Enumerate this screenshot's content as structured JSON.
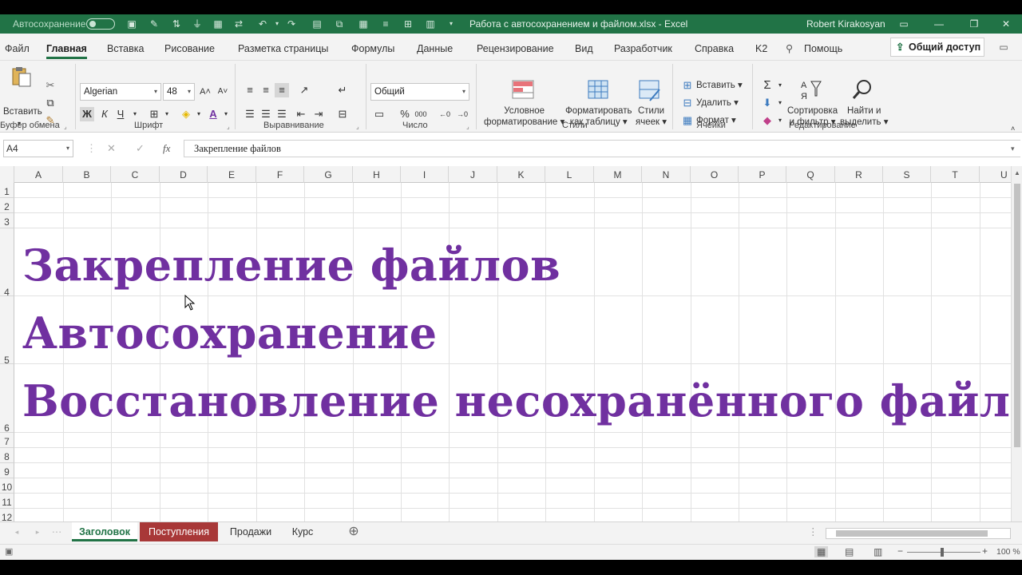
{
  "titlebar": {
    "autosave_label": "Автосохранение",
    "autosave_state": "off",
    "doc_title": "Работа с автосохранением и файлом.xlsx  -  Excel",
    "user": "Robert Kirakosyan"
  },
  "tabs": [
    "Файл",
    "Главная",
    "Вставка",
    "Рисование",
    "Разметка страницы",
    "Формулы",
    "Данные",
    "Рецензирование",
    "Вид",
    "Разработчик",
    "Справка",
    "K2"
  ],
  "active_tab": "Главная",
  "search_label": "Помощь",
  "share_label": "Общий доступ",
  "ribbon": {
    "clipboard": {
      "paste": "Вставить",
      "label": "Буфер обмена"
    },
    "font": {
      "name": "Algerian",
      "size": "48",
      "bold": "Ж",
      "italic": "К",
      "underline": "Ч",
      "label": "Шрифт"
    },
    "alignment": {
      "label": "Выравнивание"
    },
    "number": {
      "format": "Общий",
      "label": "Число"
    },
    "styles": {
      "conditional": [
        "Условное",
        "форматирование"
      ],
      "format_table": [
        "Форматировать",
        "как таблицу"
      ],
      "cell_styles": [
        "Стили",
        "ячеек"
      ],
      "label": "Стили"
    },
    "cells": {
      "insert": "Вставить",
      "delete": "Удалить",
      "format": "Формат",
      "label": "Ячейки"
    },
    "editing": {
      "sort": [
        "Сортировка",
        "и фильтр"
      ],
      "find": [
        "Найти и",
        "выделить"
      ],
      "label": "Редактирование"
    }
  },
  "formula_bar": {
    "name_box": "A4",
    "formula": "Закрепление файлов"
  },
  "columns": [
    "A",
    "B",
    "C",
    "D",
    "E",
    "F",
    "G",
    "H",
    "I",
    "J",
    "K",
    "L",
    "M",
    "N",
    "O",
    "P",
    "Q",
    "R",
    "S",
    "T",
    "U"
  ],
  "rows": [
    "1",
    "2",
    "3",
    "4",
    "5",
    "6",
    "7",
    "8",
    "9",
    "10",
    "11",
    "12"
  ],
  "cells": {
    "A4": "Закрепление файлов",
    "A5": "Автосохранение",
    "A6": "Восстановление несохранённого файла"
  },
  "sheets": [
    "Заголовок",
    "Поступления",
    "Продажи",
    "Курс"
  ],
  "active_sheet": "Заголовок",
  "status": {
    "zoom": "100 %"
  },
  "colors": {
    "excel_green": "#217346",
    "text_purple": "#7030a0",
    "tab_red": "#a83838"
  }
}
